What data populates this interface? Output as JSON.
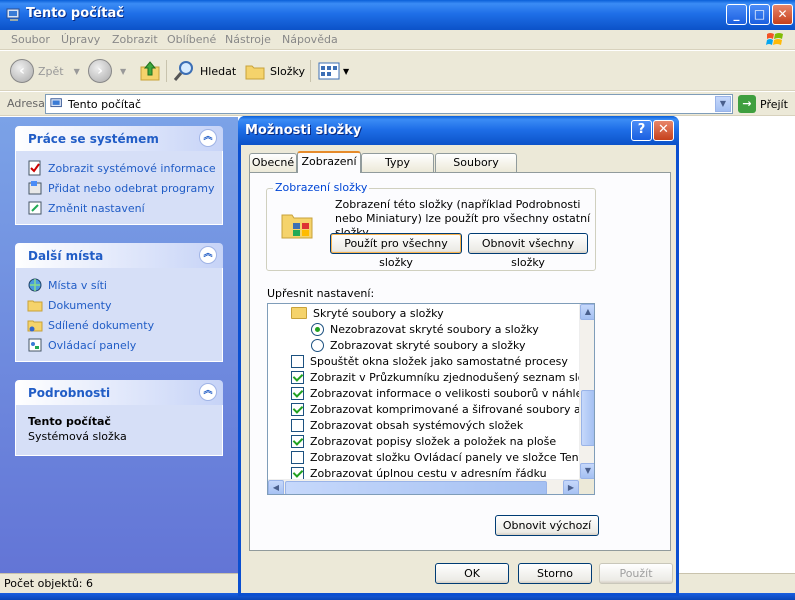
{
  "window": {
    "title": "Tento počítač",
    "menu": [
      "Soubor",
      "Úpravy",
      "Zobrazit",
      "Oblíbené",
      "Nástroje",
      "Nápověda"
    ],
    "toolbar": {
      "back": "Zpět",
      "search": "Hledat",
      "folders": "Složky"
    },
    "address": {
      "label": "Adresa",
      "value": "Tento počítač",
      "go": "Přejít"
    },
    "status": "Počet objektů: 6"
  },
  "taskpane": {
    "system": {
      "title": "Práce se systémem",
      "links": [
        "Zobrazit systémové informace",
        "Přidat nebo odebrat programy",
        "Změnit nastavení"
      ]
    },
    "places": {
      "title": "Další místa",
      "links": [
        "Místa v síti",
        "Dokumenty",
        "Sdílené dokumenty",
        "Ovládací panely"
      ]
    },
    "details": {
      "title": "Podrobnosti",
      "name": "Tento počítač",
      "type": "Systémová složka"
    }
  },
  "dialog": {
    "title": "Možnosti složky",
    "help_glyph": "?",
    "close_glyph": "✕",
    "tabs": [
      "Obecné",
      "Zobrazení",
      "Typy souborů",
      "Soubory offline"
    ],
    "active_tab": "Zobrazení",
    "folder_view": {
      "legend": "Zobrazení složky",
      "description": "Zobrazení této složky  (například Podrobnosti nebo Miniatury) lze použít pro všechny ostatní složky.",
      "apply_all": "Použít pro všechny složky",
      "reset_all": "Obnovit všechny složky"
    },
    "advanced": {
      "label": "Upřesnit nastavení:",
      "items": [
        {
          "kind": "folder",
          "text": "Skryté soubory a složky"
        },
        {
          "kind": "radio",
          "checked": true,
          "text": "Nezobrazovat skryté soubory a složky"
        },
        {
          "kind": "radio",
          "checked": false,
          "text": "Zobrazovat skryté soubory a složky"
        },
        {
          "kind": "check",
          "checked": false,
          "text": "Spouštět okna složek jako samostatné procesy"
        },
        {
          "kind": "check",
          "checked": true,
          "text": "Zobrazit v Průzkumníku zjednodušený seznam složek"
        },
        {
          "kind": "check",
          "checked": true,
          "text": "Zobrazovat informace o velikosti souborů v náhledu složky"
        },
        {
          "kind": "check",
          "checked": true,
          "text": "Zobrazovat komprimované a šifrované soubory a složky s barevným"
        },
        {
          "kind": "check",
          "checked": false,
          "text": "Zobrazovat obsah systémových složek"
        },
        {
          "kind": "check",
          "checked": true,
          "text": "Zobrazovat popisy složek a položek na ploše"
        },
        {
          "kind": "check",
          "checked": false,
          "text": "Zobrazovat složku Ovládací panely ve složce Tento počítač"
        },
        {
          "kind": "check",
          "checked": true,
          "text": "Zobrazovat úplnou cestu v adresním řádku"
        }
      ],
      "restore_defaults": "Obnovit výchozí"
    },
    "buttons": {
      "ok": "OK",
      "cancel": "Storno",
      "apply": "Použít"
    }
  }
}
